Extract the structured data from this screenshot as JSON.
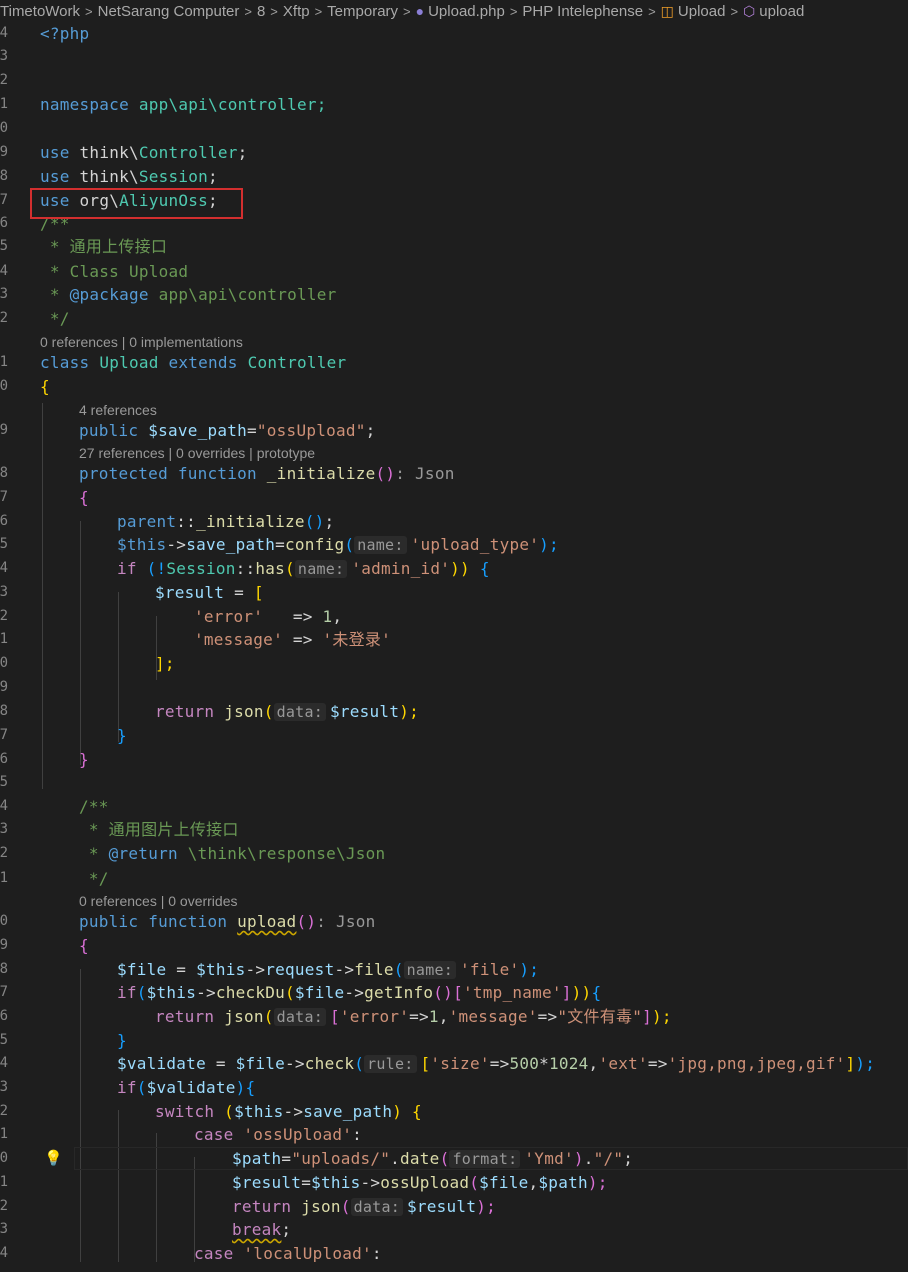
{
  "breadcrumb": {
    "items": [
      "TimetoWork",
      "NetSarang Computer",
      "8",
      "Xftp",
      "Temporary",
      "Upload.php",
      "PHP Intelephense",
      "Upload",
      "upload"
    ],
    "separator": ">"
  },
  "editor": {
    "line_numbers": [
      "4",
      "3",
      "2",
      "1",
      "0",
      "9",
      "8",
      "7",
      "6",
      "5",
      "4",
      "3",
      "2",
      "1",
      "0",
      "9",
      "8",
      "7",
      "6",
      "5",
      "4",
      "3",
      "2",
      "1",
      "0",
      "9",
      "8",
      "7",
      "6",
      "5",
      "4",
      "3",
      "2",
      "1",
      "0",
      "9",
      "8",
      "7",
      "6",
      "5",
      "4",
      "3",
      "2",
      "1",
      "0",
      "1",
      "2",
      "3",
      "4"
    ],
    "codelens": [
      "0 references | 0 implementations",
      "4 references",
      "27 references | 0 overrides | prototype",
      "0 references | 0 overrides"
    ],
    "code": {
      "l1": [
        "<?php"
      ],
      "l2": [
        "namespace",
        "app\\api\\controller;"
      ],
      "l3": [
        "use",
        "think\\",
        "Controller",
        ";"
      ],
      "l4": [
        "use",
        "think\\",
        "Session",
        ";"
      ],
      "l5": [
        "use",
        "org\\",
        "AliyunOss",
        ";"
      ],
      "l6": [
        "/**"
      ],
      "l7": [
        " * 通用上传接口"
      ],
      "l8": [
        " * Class Upload"
      ],
      "l9": [
        " * ",
        "@package",
        " app\\api\\controller"
      ],
      "l10": [
        " */"
      ],
      "l11": [
        "class",
        "Upload",
        "extends",
        "Controller"
      ],
      "l12": [
        "{"
      ],
      "l13": [
        "public",
        "$save_path",
        "=",
        "\"ossUpload\"",
        ";"
      ],
      "l14": [
        "protected",
        "function",
        "_initialize",
        "()",
        ": Json"
      ],
      "l15": [
        "{"
      ],
      "l16": [
        "parent",
        "::",
        "_initialize",
        "()",
        ";"
      ],
      "l17": [
        "$this",
        "->",
        "save_path",
        "=",
        "config",
        "(",
        "name:",
        "'upload_type'",
        ");"
      ],
      "l18": [
        "if",
        " (!",
        "Session",
        "::",
        "has",
        "(",
        "name:",
        "'admin_id'",
        "))",
        "{"
      ],
      "l19": [
        "$result",
        " = ",
        "["
      ],
      "l20": [
        "'error'",
        "   => ",
        "1",
        ","
      ],
      "l21": [
        "'message'",
        " => ",
        "'未登录'"
      ],
      "l22": [
        "];"
      ],
      "l23": [
        "return",
        "json",
        "(",
        "data:",
        "$result",
        ");"
      ],
      "l24": [
        "}"
      ],
      "l25": [
        "}"
      ],
      "l26": [
        "/**"
      ],
      "l27": [
        " * 通用图片上传接口"
      ],
      "l28": [
        " * ",
        "@return",
        " \\think\\response\\Json"
      ],
      "l29": [
        " */"
      ],
      "l30": [
        "public",
        "function",
        "upload",
        "()",
        ": Json"
      ],
      "l31": [
        "{"
      ],
      "l32": [
        "$file",
        " = ",
        "$this",
        "->",
        "request",
        "->",
        "file",
        "(",
        "name:",
        "'file'",
        ");"
      ],
      "l33": [
        "if",
        "(",
        "$this",
        "->",
        "checkDu",
        "(",
        "$file",
        "->",
        "getInfo",
        "()",
        "[",
        "'tmp_name'",
        "]",
        "))",
        "{"
      ],
      "l34": [
        "return",
        "json",
        "(",
        "data:",
        "[",
        "'error'",
        "=>",
        "1",
        ",",
        "'message'",
        "=>",
        "\"文件有毒\"",
        "]",
        ");"
      ],
      "l35": [
        "}"
      ],
      "l36": [
        "$validate",
        " = ",
        "$file",
        "->",
        "check",
        "(",
        "rule:",
        "[",
        "'size'",
        "=>",
        "500",
        "*",
        "1024",
        ",",
        "'ext'",
        "=>",
        "'jpg,png,jpeg,gif'",
        "]",
        ");"
      ],
      "l37": [
        "if",
        "(",
        "$validate",
        ")",
        "{"
      ],
      "l38": [
        "switch",
        " (",
        "$this",
        "->",
        "save_path",
        ") ",
        "{"
      ],
      "l39": [
        "case",
        "'ossUpload'",
        ":"
      ],
      "l40": [
        "$path",
        "=",
        "\"uploads/\"",
        ".",
        "date",
        "(",
        "format:",
        "'Ymd'",
        ")",
        ".",
        "\"/\"",
        ";"
      ],
      "l41": [
        "$result",
        "=",
        "$this",
        "->",
        "ossUpload",
        "(",
        "$file",
        ",",
        "$path",
        ");"
      ],
      "l42": [
        "return",
        "json",
        "(",
        "data:",
        "$result",
        ");"
      ],
      "l43": [
        "break",
        ";"
      ],
      "l44": [
        "case",
        "'localUpload'",
        ":"
      ]
    }
  },
  "annotation": {
    "highlight_color": "#d32f2f",
    "highlighted_line": "use org\\AliyunOss;"
  },
  "theme": {
    "background": "#1e1e1e",
    "keyword": "#569cd6",
    "class": "#4ec9b0",
    "function": "#dcdcaa",
    "variable": "#9cdcfe",
    "string": "#ce9178",
    "comment": "#6a9955"
  }
}
